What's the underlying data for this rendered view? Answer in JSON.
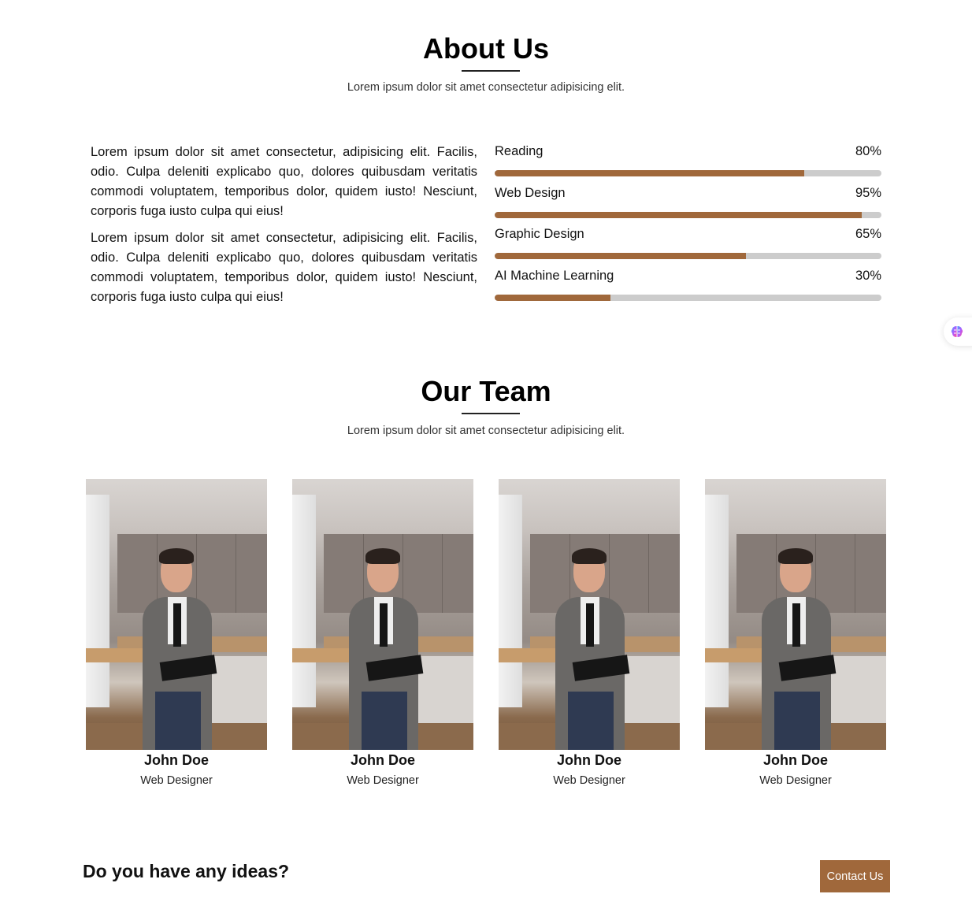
{
  "about": {
    "title": "About Us",
    "subtitle": "Lorem ipsum dolor sit amet consectetur adipisicing elit.",
    "paragraphs": [
      "Lorem ipsum dolor sit amet consectetur, adipisicing elit. Facilis, odio. Culpa deleniti explicabo quo, dolores quibusdam veritatis commodi voluptatem, temporibus dolor, quidem iusto! Nesciunt, corporis fuga iusto culpa qui eius!",
      "Lorem ipsum dolor sit amet consectetur, adipisicing elit. Facilis, odio. Culpa deleniti explicabo quo, dolores quibusdam veritatis commodi voluptatem, temporibus dolor, quidem iusto! Nesciunt, corporis fuga iusto culpa qui eius!"
    ],
    "skills": [
      {
        "label": "Reading",
        "percent_text": "80%",
        "value": 0.8
      },
      {
        "label": "Web Design",
        "percent_text": "95%",
        "value": 0.95
      },
      {
        "label": "Graphic Design",
        "percent_text": "65%",
        "value": 0.65
      },
      {
        "label": "AI Machine Learning",
        "percent_text": "30%",
        "value": 0.3
      }
    ]
  },
  "team": {
    "title": "Our Team",
    "subtitle": "Lorem ipsum dolor sit amet consectetur adipisicing elit.",
    "members": [
      {
        "name": "John Doe",
        "role": "Web Designer"
      },
      {
        "name": "John Doe",
        "role": "Web Designer"
      },
      {
        "name": "John Doe",
        "role": "Web Designer"
      },
      {
        "name": "John Doe",
        "role": "Web Designer"
      }
    ]
  },
  "cta": {
    "text": "Do you have any ideas?",
    "button_label": "Contact Us"
  },
  "side_widget": {
    "icon": "brain-icon"
  },
  "colors": {
    "accent": "#a0683b",
    "bar_track": "#cccccc",
    "text": "#111111"
  }
}
